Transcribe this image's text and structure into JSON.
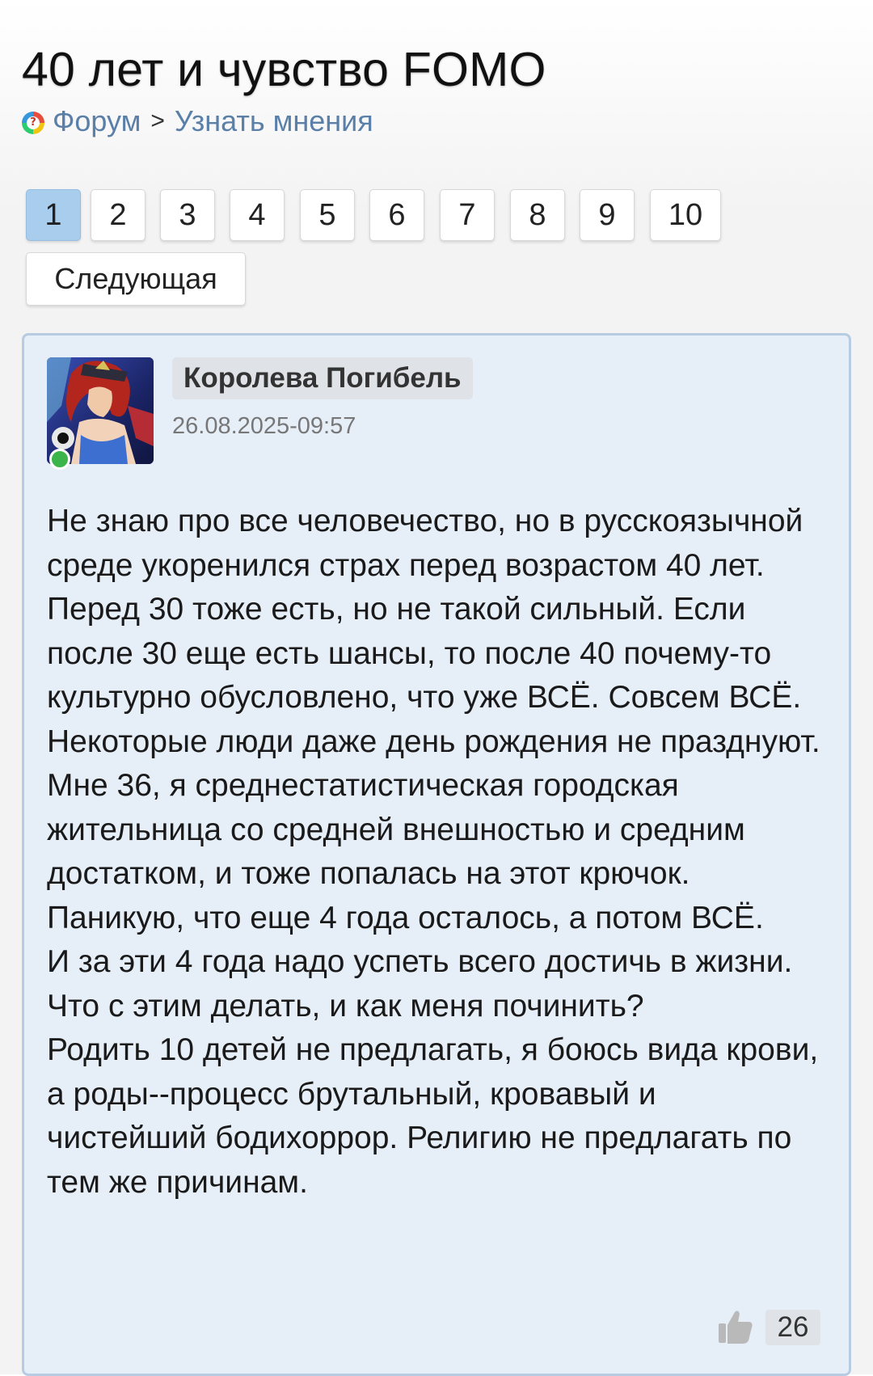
{
  "page": {
    "title": "40 лет и чувство FOMO"
  },
  "breadcrumb": {
    "forum": "Форум",
    "separator": ">",
    "section": "Узнать мнения"
  },
  "pagination": {
    "pages": [
      "1",
      "2",
      "3",
      "4",
      "5",
      "6",
      "7",
      "8",
      "9",
      "10"
    ],
    "active_page": "1",
    "next_label": "Следующая"
  },
  "post": {
    "author": "Королева Погибель",
    "date": "26.08.2025-09:57",
    "online": true,
    "paragraphs": [
      "Не знаю про все человечество, но в русскоязычной среде укоренился страх перед возрастом 40 лет. Перед 30 тоже есть, но не такой сильный. Если после 30 еще есть шансы, то после 40 почему-то культурно обусловлено, что уже ВСЁ. Совсем ВСЁ. Некоторые люди даже день рождения не празднуют.",
      "Мне 36, я среднестатистическая городская жительница со средней внешностью и средним достатком, и тоже попалась на этот крючок.",
      "Паникую, что еще 4 года осталось, а потом ВСЁ.",
      "И за эти 4 года надо успеть всего достичь в жизни.",
      "Что с этим делать, и как меня починить?",
      "Родить 10 детей не предлагать, я боюсь вида крови, а роды--процесс брутальный, кровавый и чистейший бодихоррор. Религию не предлагать по тем же причинам."
    ],
    "likes": "26",
    "like_icon": "thumbs-up-icon"
  },
  "colors": {
    "active_page": "#a9cdec",
    "post_background": "#e6eef8",
    "post_border": "#b7cbe2",
    "link": "#5a7fa8",
    "online": "#3bb54a"
  }
}
